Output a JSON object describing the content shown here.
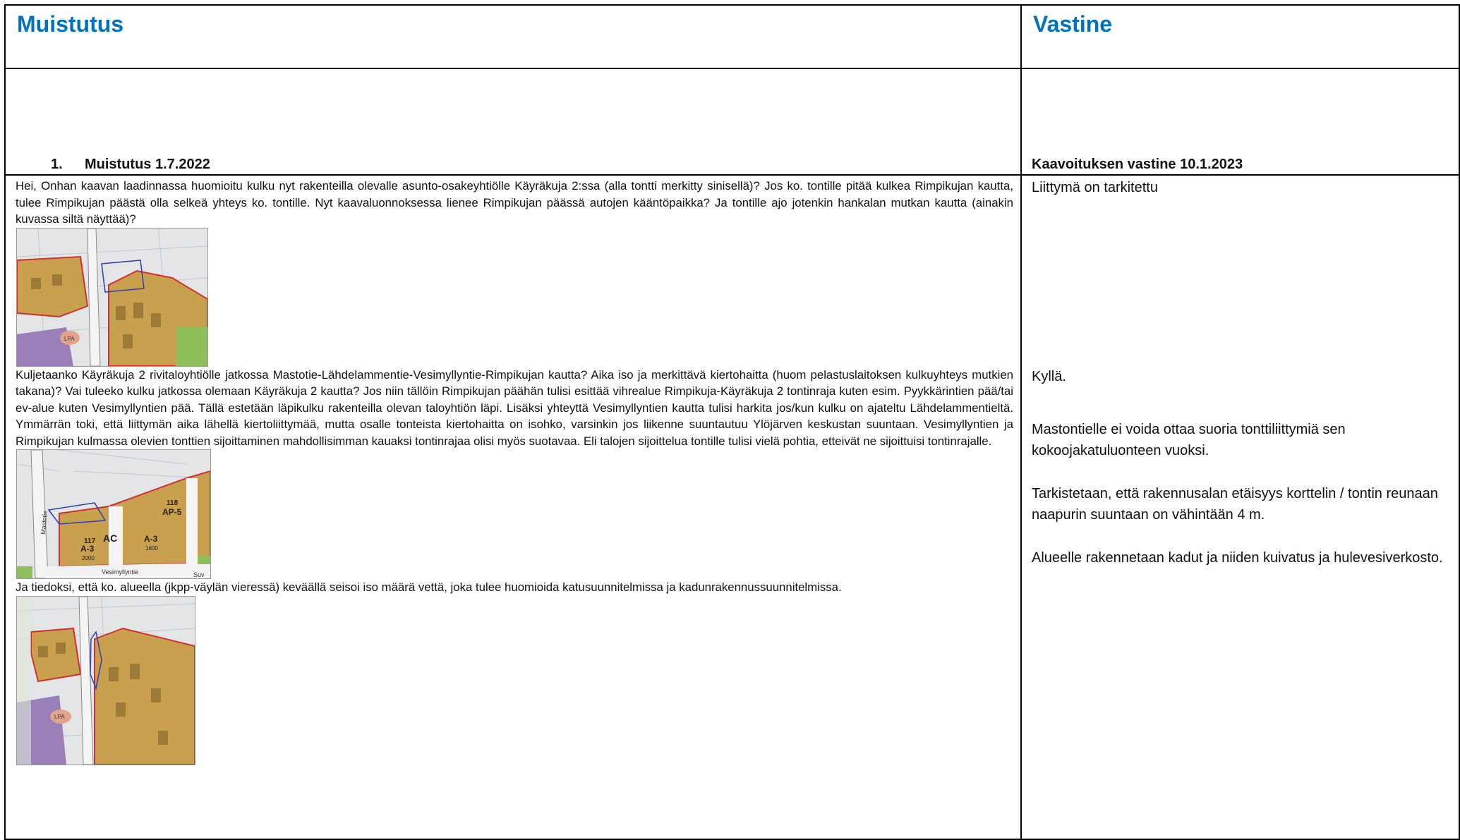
{
  "header": {
    "left_title": "Muistutus",
    "right_title": "Vastine"
  },
  "subheader": {
    "number": "1.",
    "left_text": "Muistutus 1.7.2022",
    "right_text": "Kaavoituksen vastine 10.1.2023"
  },
  "muistutus": {
    "paragraph1": "Hei, Onhan kaavan laadinnassa huomioitu kulku nyt rakenteilla olevalle asunto-osakeyhtiölle Käyräkuja 2:ssa (alla tontti merkitty sinisellä)? Jos ko. tontille pitää kulkea Rimpikujan kautta, tulee Rimpikujan päästä olla selkeä yhteys ko. tontille. Nyt kaavaluonnoksessa lienee Rimpikujan päässä autojen kääntöpaikka? Ja tontille ajo jotenkin hankalan mutkan kautta (ainakin kuvassa siltä näyttää)?",
    "paragraph2": "Kuljetaanko Käyräkuja 2 rivitaloyhtiölle jatkossa Mastotie-Lähdelammentie-Vesimyllyntie-Rimpikujan kautta? Aika iso ja merkittävä kiertohaitta (huom pelastuslaitoksen kulkuyhteys mutkien takana)? Vai tuleeko kulku jatkossa olemaan Käyräkuja 2 kautta? Jos niin tällöin Rimpikujan päähän tulisi esittää vihrealue Rimpikuja-Käyräkuja 2 tontinraja kuten esim. Pyykkärintien pää/tai ev-alue kuten Vesimyllyntien pää. Tällä estetään läpikulku rakenteilla olevan taloyhtiön läpi. Lisäksi yhteyttä Vesimyllyntien kautta tulisi harkita jos/kun kulku on ajateltu Lähdelammentieltä. Ymmärrän toki, että liittymän aika lähellä kiertoliittymää, mutta osalle tonteista kiertohaitta on isohko, varsinkin jos liikenne suuntautuu Ylöjärven keskustan suuntaan. Vesimyllyntien ja Rimpikujan kulmassa olevien tonttien sijoittaminen mahdollisimman kauaksi tontinrajaa olisi myös suotavaa. Eli talojen sijoittelua tontille tulisi vielä pohtia, etteivät ne sijoittuisi tontinrajalle.",
    "paragraph3": "Ja tiedoksi, että ko. alueella (jkpp-väylän vieressä) keväällä seisoi iso määrä vettä, joka tulee huomioida katusuunnitelmissa ja kadunrakennussuunnitelmissa."
  },
  "map_labels": {
    "lpa": "LPA",
    "ap5": "AP-5",
    "a3": "A-3",
    "ac": "AC",
    "n117": "117",
    "n118": "118",
    "n2000": "2000",
    "n1600": "1600",
    "mastotie": "Mastotie",
    "vesimyllyntie": "Vesimyllyntie",
    "suv": "Suv"
  },
  "vastine": {
    "r1": "Liittymä on tarkitettu",
    "r2": "Kyllä.",
    "r3": "Mastontielle ei voida ottaa suoria tonttiliittymiä sen kokoojakatuluonteen vuoksi.",
    "r4": "Tarkistetaan, että rakennusalan etäisyys korttelin / tontin reunaan naapurin suuntaan on vähintään 4 m.",
    "r5": "Alueelle rakennetaan kadut ja niiden kuivatus ja hulevesiverkosto."
  },
  "colors": {
    "heading_blue": "#0070C0",
    "plan_tan": "#C9A04E",
    "plan_purple": "#9B7FB8",
    "plan_red": "#D03030",
    "marker_blue": "#2F3FAF"
  }
}
